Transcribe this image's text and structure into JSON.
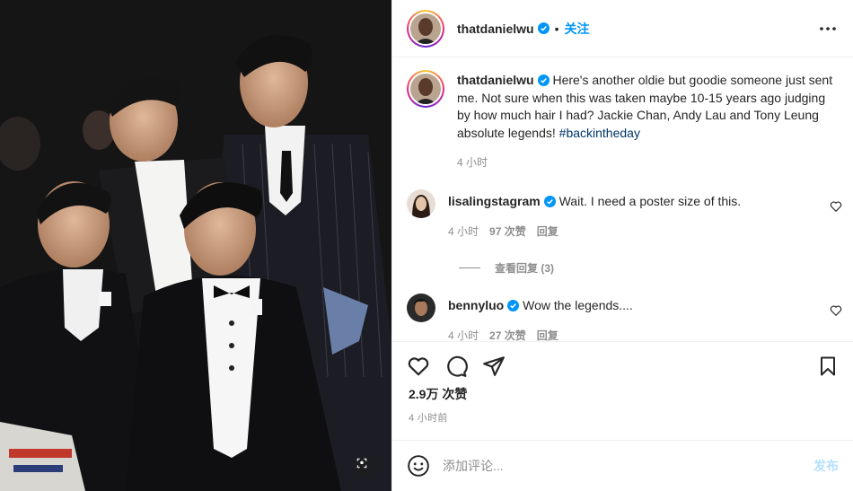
{
  "post": {
    "author": "thatdanielwu",
    "follow_label": "关注",
    "more_icon": "more-horizontal-icon",
    "verified_icon": "verified-badge-icon"
  },
  "caption": {
    "author": "thatdanielwu",
    "text": "Here's another oldie but goodie someone just sent me. Not sure when this was taken maybe 10-15 years ago judging by how much hair I had? Jackie Chan, Andy Lau and Tony Leung absolute legends!",
    "hashtag": "#backintheday",
    "time": "4 小时"
  },
  "comments": [
    {
      "author": "lisalingstagram",
      "text": "Wait. I need a poster size of this.",
      "time": "4 小时",
      "likes": "97 次赞",
      "reply_label": "回复",
      "view_replies": "查看回复 (3)"
    },
    {
      "author": "bennyluo",
      "text": "Wow the legends....",
      "time": "4 小时",
      "likes": "27 次赞",
      "reply_label": "回复"
    }
  ],
  "actions": {
    "like_icon": "heart-icon",
    "comment_icon": "comment-icon",
    "share_icon": "paper-plane-icon",
    "save_icon": "bookmark-icon",
    "likes_count": "2.9万 次赞",
    "posted_time": "4 小时前"
  },
  "composer": {
    "emoji_icon": "emoji-icon",
    "placeholder": "添加评论...",
    "post_label": "发布"
  },
  "colors": {
    "accent": "#0095f6",
    "post_disabled": "#b2dffc",
    "hashtag": "#00376b",
    "muted": "#8e8e8e",
    "text": "#262626"
  }
}
